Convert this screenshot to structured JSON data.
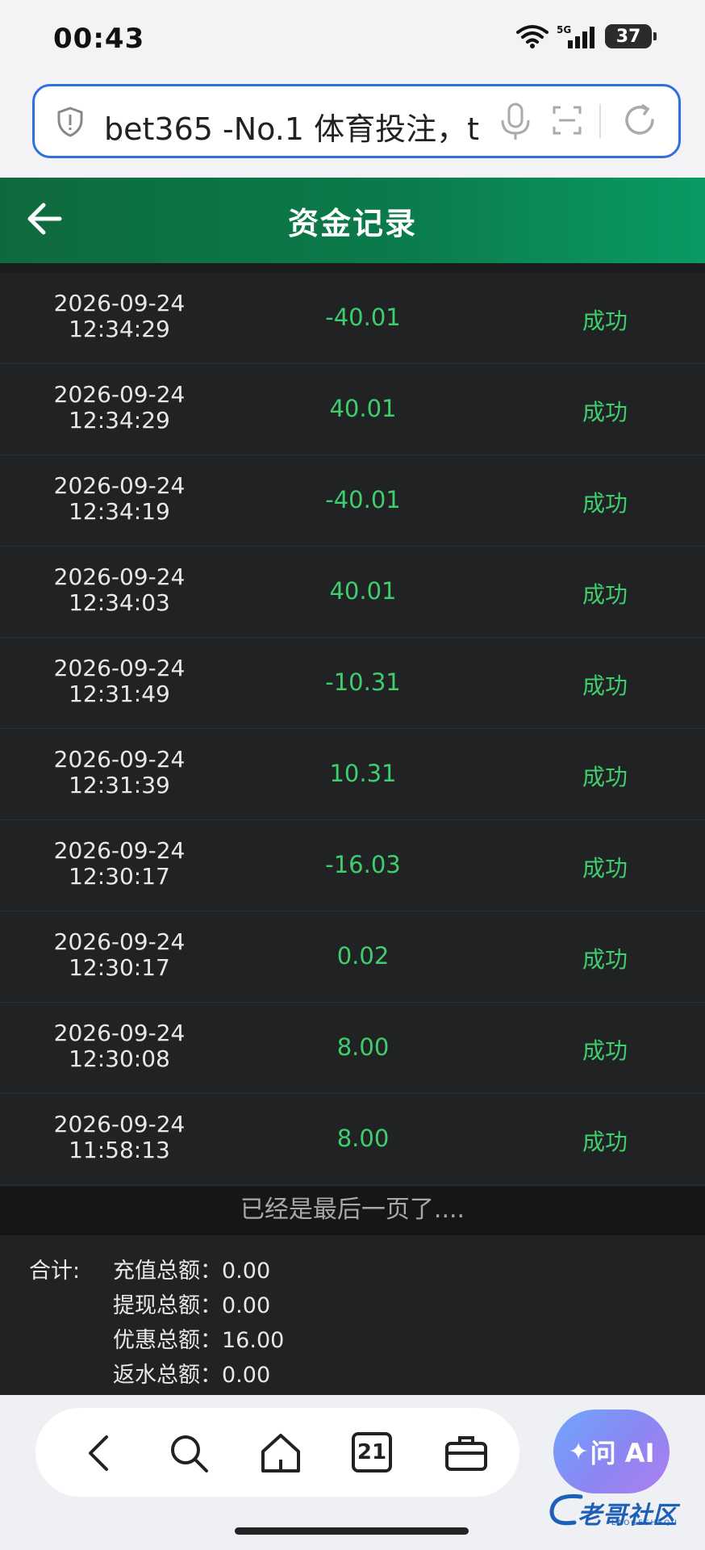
{
  "status_bar": {
    "time": "00:43",
    "network": "5G",
    "battery": "37"
  },
  "browser": {
    "url_text": "bet365 -No.1 体育投注，t"
  },
  "header": {
    "title": "资金记录"
  },
  "records": [
    {
      "date": "2026-09-24",
      "time": "12:34:29",
      "amount": "-40.01",
      "status": "成功"
    },
    {
      "date": "2026-09-24",
      "time": "12:34:29",
      "amount": "40.01",
      "status": "成功"
    },
    {
      "date": "2026-09-24",
      "time": "12:34:19",
      "amount": "-40.01",
      "status": "成功"
    },
    {
      "date": "2026-09-24",
      "time": "12:34:03",
      "amount": "40.01",
      "status": "成功"
    },
    {
      "date": "2026-09-24",
      "time": "12:31:49",
      "amount": "-10.31",
      "status": "成功"
    },
    {
      "date": "2026-09-24",
      "time": "12:31:39",
      "amount": "10.31",
      "status": "成功"
    },
    {
      "date": "2026-09-24",
      "time": "12:30:17",
      "amount": "-16.03",
      "status": "成功"
    },
    {
      "date": "2026-09-24",
      "time": "12:30:17",
      "amount": "0.02",
      "status": "成功"
    },
    {
      "date": "2026-09-24",
      "time": "12:30:08",
      "amount": "8.00",
      "status": "成功"
    },
    {
      "date": "2026-09-24",
      "time": "11:58:13",
      "amount": "8.00",
      "status": "成功"
    }
  ],
  "last_page_text": "已经是最后一页了....",
  "summary": {
    "label": "合计:",
    "lines": [
      "充值总额：0.00",
      "提现总额：0.00",
      "优惠总额：16.00",
      "返水总额：0.00"
    ]
  },
  "bottom_nav": {
    "tabs_count": "21",
    "ai_label": "问 AI"
  },
  "watermark": {
    "text": "老哥社区",
    "sub": "LAOGESHEQU"
  },
  "colors": {
    "header_start": "#0e6a3d",
    "header_end": "#0a9a63",
    "amount_green": "#3fce6d",
    "url_border": "#2f6fe0"
  }
}
